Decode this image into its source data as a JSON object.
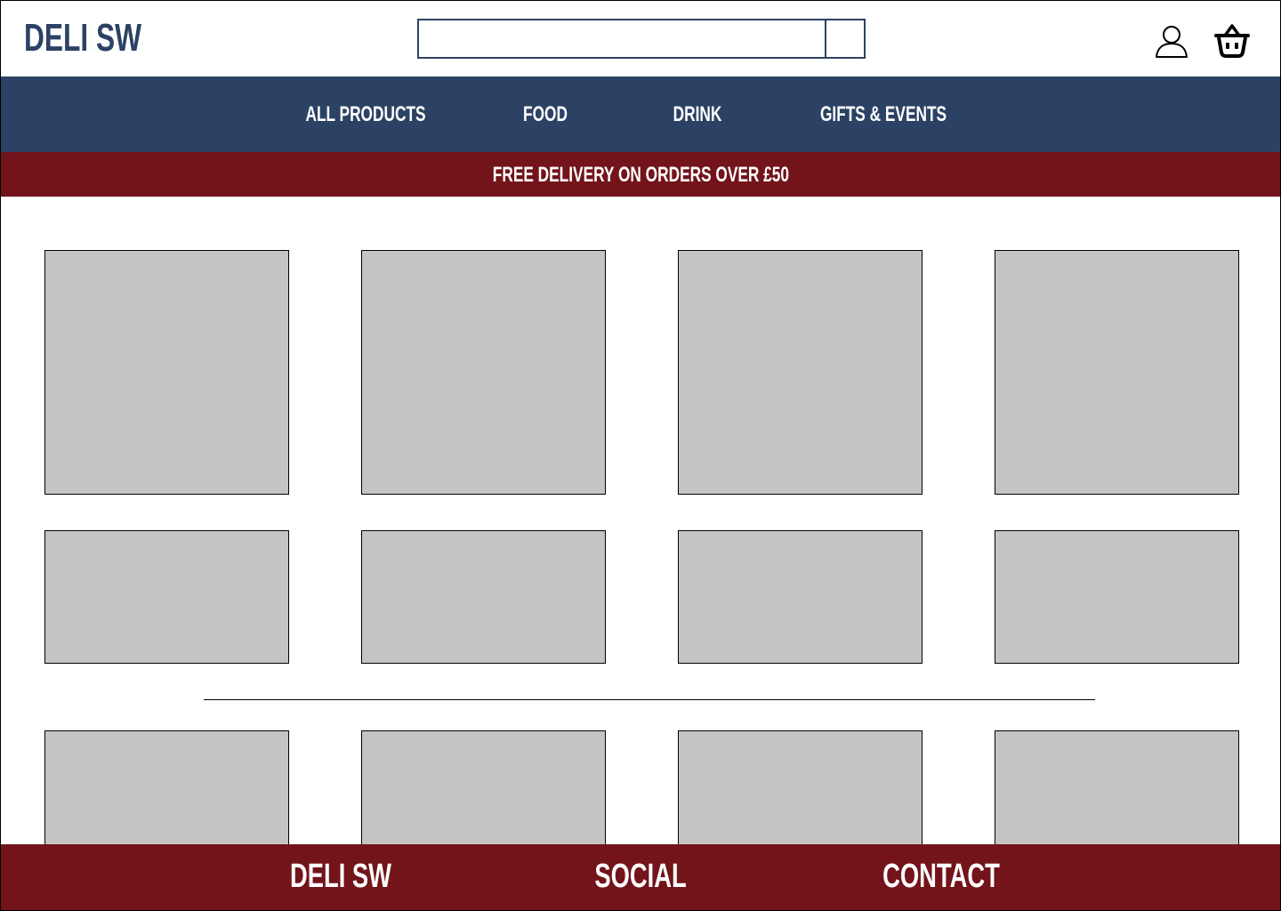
{
  "header": {
    "logo": "DELI SW",
    "search": {
      "value": "",
      "placeholder": ""
    },
    "icons": {
      "account": "user-icon",
      "basket": "basket-icon"
    }
  },
  "nav": {
    "items": [
      {
        "label": "ALL PRODUCTS"
      },
      {
        "label": "FOOD"
      },
      {
        "label": "DRINK"
      },
      {
        "label": "GIFTS & EVENTS"
      }
    ]
  },
  "promo": {
    "text": "FREE DELIVERY ON ORDERS OVER £50"
  },
  "footer": {
    "items": [
      {
        "label": "DELI SW"
      },
      {
        "label": "SOCIAL"
      },
      {
        "label": "CONTACT"
      }
    ]
  },
  "colors": {
    "navy": "#2c4264",
    "burgundy": "#72141a",
    "placeholder_grey": "#c4c4c4"
  }
}
